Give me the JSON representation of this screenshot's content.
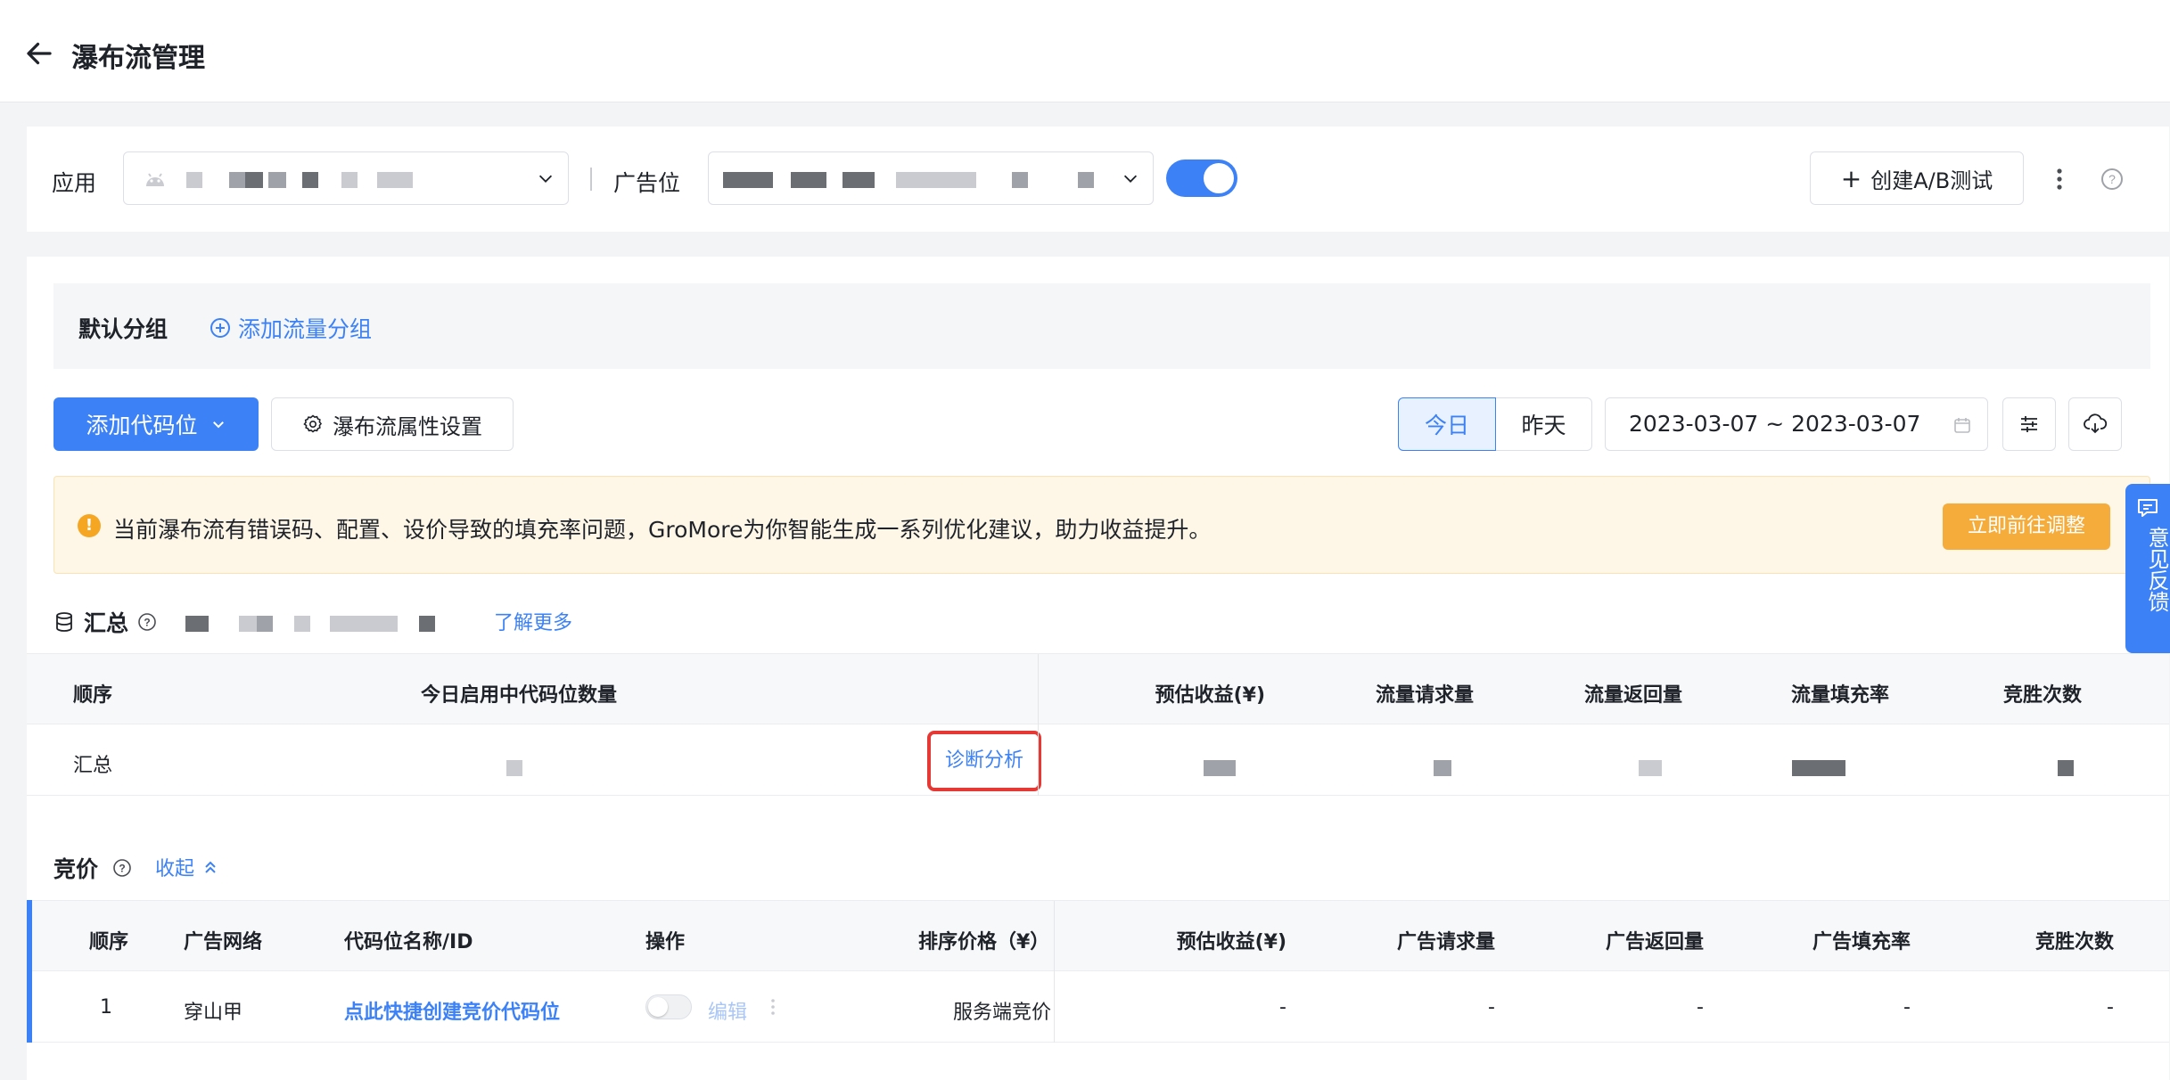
{
  "header": {
    "title": "瀑布流管理"
  },
  "filters": {
    "app_label": "应用",
    "adslot_label": "广告位",
    "toggle_on": true,
    "create_ab_label": "创建A/B测试"
  },
  "group": {
    "name": "默认分组",
    "add_label": "添加流量分组"
  },
  "toolbar": {
    "add_code_label": "添加代码位",
    "settings_label": "瀑布流属性设置",
    "today_label": "今日",
    "yesterday_label": "昨天",
    "date_range": "2023-03-07 ~ 2023-03-07"
  },
  "alert": {
    "message": "当前瀑布流有错误码、配置、设价导致的填充率问题，GroMore为你智能生成一系列优化建议，助力收益提升。",
    "action_label": "立即前往调整"
  },
  "summary": {
    "title": "汇总",
    "learn_more": "了解更多",
    "columns": [
      "顺序",
      "今日启用中代码位数量",
      "预估收益(¥)",
      "流量请求量",
      "流量返回量",
      "流量填充率",
      "竞胜次数"
    ],
    "row": {
      "order": "汇总",
      "diagnose_label": "诊断分析"
    }
  },
  "bidding": {
    "title": "竞价",
    "collapse_label": "收起",
    "columns": [
      "顺序",
      "广告网络",
      "代码位名称/ID",
      "操作",
      "排序价格（¥）",
      "预估收益(¥)",
      "广告请求量",
      "广告返回量",
      "广告填充率",
      "竞胜次数"
    ],
    "rows": [
      {
        "order": "1",
        "network": "穿山甲",
        "name": "点此快捷创建竞价代码位",
        "edit_label": "编辑",
        "sort_price": "服务端竞价",
        "revenue": "-",
        "requests": "-",
        "returns": "-",
        "fill_rate": "-",
        "wins": "-"
      }
    ]
  },
  "feedback": {
    "label": "意见反馈"
  },
  "colors": {
    "primary": "#3c82f6",
    "warning": "#f5ac3a",
    "highlight": "#e53935"
  }
}
